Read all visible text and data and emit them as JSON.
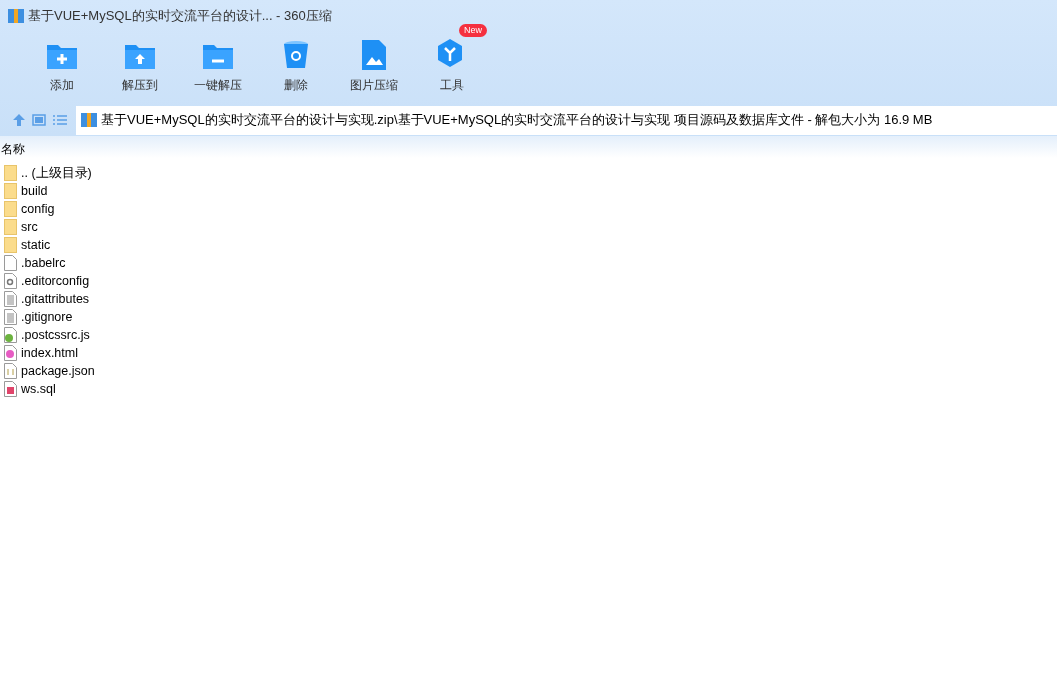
{
  "window": {
    "title": "基于VUE+MySQL的实时交流平台的设计... - 360压缩"
  },
  "toolbar": [
    {
      "kind": "add",
      "label": "添加"
    },
    {
      "kind": "extract-to",
      "label": "解压到"
    },
    {
      "kind": "extract",
      "label": "一键解压"
    },
    {
      "kind": "delete",
      "label": "删除"
    },
    {
      "kind": "image",
      "label": "图片压缩"
    },
    {
      "kind": "tools",
      "label": "工具",
      "badge": "New"
    }
  ],
  "address": {
    "path": "基于VUE+MySQL的实时交流平台的设计与实现.zip\\基于VUE+MySQL的实时交流平台的设计与实现 项目源码及数据库文件 - 解包大小为 16.9 MB"
  },
  "table": {
    "columns": [
      "名称"
    ],
    "rows": [
      {
        "kind": "folder",
        "name": ".. (上级目录)"
      },
      {
        "kind": "folder",
        "name": "build"
      },
      {
        "kind": "folder",
        "name": "config"
      },
      {
        "kind": "folder",
        "name": "src"
      },
      {
        "kind": "folder",
        "name": "static"
      },
      {
        "kind": "blank",
        "name": ".babelrc"
      },
      {
        "kind": "config",
        "name": ".editorconfig"
      },
      {
        "kind": "text",
        "name": ".gitattributes"
      },
      {
        "kind": "text",
        "name": ".gitignore"
      },
      {
        "kind": "js",
        "name": ".postcssrc.js"
      },
      {
        "kind": "html",
        "name": "index.html"
      },
      {
        "kind": "json",
        "name": "package.json"
      },
      {
        "kind": "sql",
        "name": "ws.sql"
      }
    ]
  }
}
